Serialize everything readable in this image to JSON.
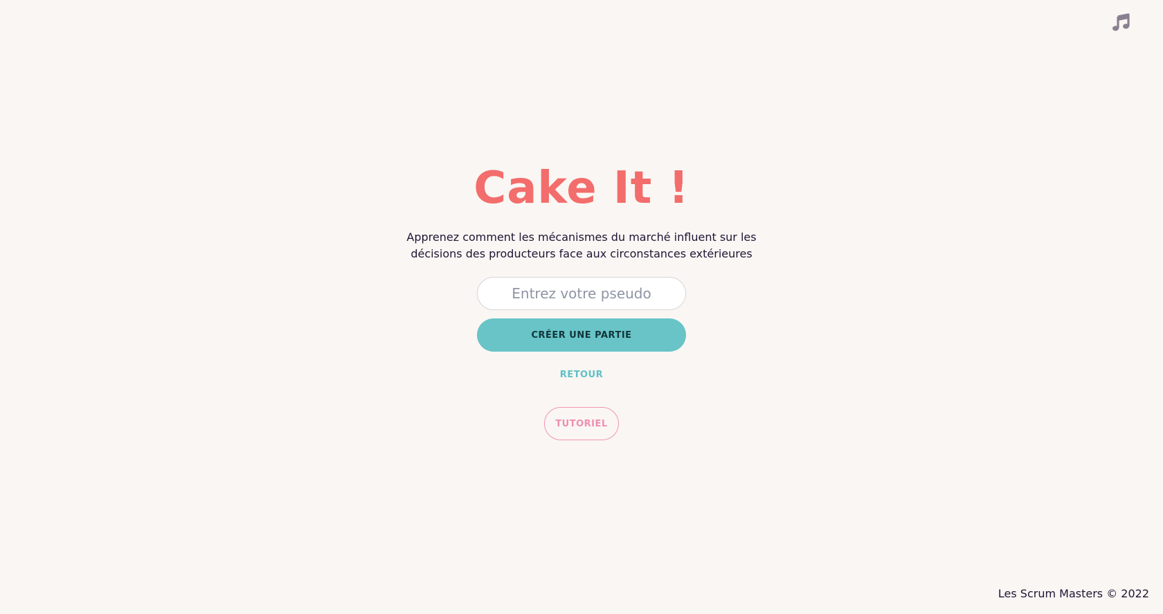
{
  "header": {
    "music_icon": "music-note-icon",
    "music_icon_color": "#8a7f8f"
  },
  "main": {
    "title": "Cake It !",
    "subtitle_line1": "Apprenez comment les mécanismes du marché influent sur les",
    "subtitle_line2": "décisions des producteurs face aux circonstances extérieures",
    "pseudo_placeholder": "Entrez votre pseudo",
    "pseudo_value": "",
    "create_button_label": "CRÉER UNE PARTIE",
    "back_label": "RETOUR",
    "tutorial_label": "TUTORIEL"
  },
  "footer": {
    "copyright": "Les Scrum Masters © 2022"
  },
  "colors": {
    "background": "#faf6f3",
    "title": "#f26d6b",
    "primary_button": "#68c4c7",
    "back_link": "#5ec0c4",
    "tutorial": "#ee8fb0",
    "text": "#1d1535"
  }
}
